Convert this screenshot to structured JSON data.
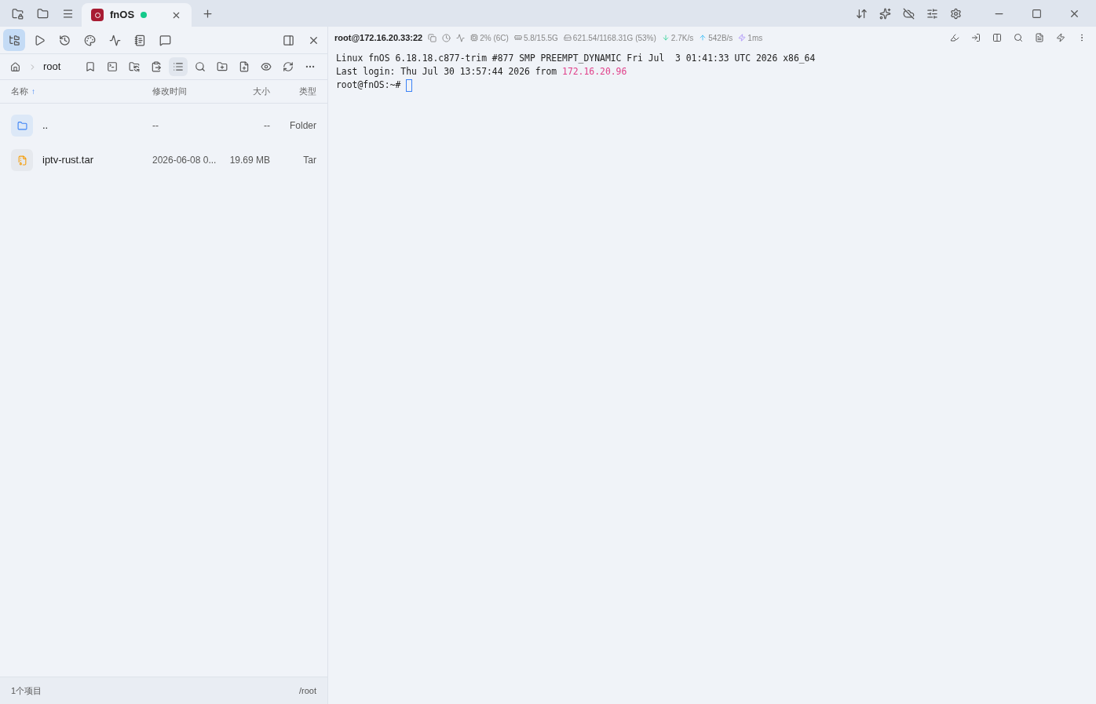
{
  "tab": {
    "title": "fnOS",
    "connected": true
  },
  "side_tools": [
    {
      "selected": true
    },
    {
      "selected": false
    },
    {
      "selected": false
    },
    {
      "selected": false
    },
    {
      "selected": false
    },
    {
      "selected": false
    },
    {
      "selected": false
    }
  ],
  "breadcrumb": [
    "root"
  ],
  "file_tools": {
    "list_view_selected": true
  },
  "columns": [
    {
      "label": "名称",
      "sort_mark": "↑"
    },
    {
      "label": "修改时间"
    },
    {
      "label": "大小"
    },
    {
      "label": "类型"
    }
  ],
  "rows": [
    {
      "kind": "folder",
      "name": "..",
      "modified": "--",
      "size": "--",
      "type": "Folder"
    },
    {
      "kind": "archive",
      "name": "iptv-rust.tar",
      "modified": "2026-06-08 0...",
      "size": "19.69 MB",
      "type": "Tar"
    }
  ],
  "status_bar": {
    "count": "1个项目",
    "path": "/root"
  },
  "session": {
    "host": "root@172.16.20.33:22",
    "cpu": "2% (6C)",
    "memory": "5.8/15.5G",
    "disk": "621.54/1168.31G (53%)",
    "download": "2.7K/s",
    "upload": "542B/s",
    "latency": "1ms"
  },
  "terminal": [
    [
      {
        "kind": "text",
        "text": "Linux fnOS 6.18.18.c877-trim #877 SMP PREEMPT_DYNAMIC Fri Jul  3 01:41:33 UTC 2026 x86_64"
      }
    ],
    [
      {
        "kind": "text",
        "text": "Last login: Thu Jul 30 13:57:44 2026 from "
      },
      {
        "kind": "ip",
        "text": "172.16.20.96"
      }
    ],
    [
      {
        "kind": "text",
        "text": "root@fnOS:~# "
      },
      {
        "kind": "cursor"
      }
    ]
  ]
}
